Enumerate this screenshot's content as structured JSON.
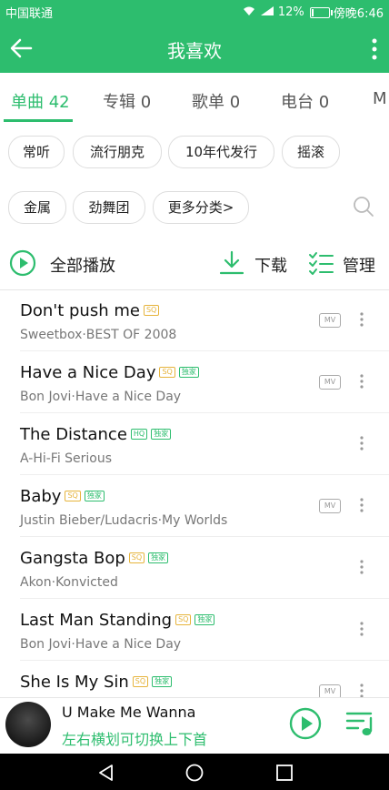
{
  "statusbar": {
    "carrier": "中国联通",
    "battery_pct": "12%",
    "time": "傍晚6:46",
    "battery_level": 0.12
  },
  "header": {
    "title": "我喜欢"
  },
  "tabs": [
    {
      "label": "单曲 42"
    },
    {
      "label": "专辑 0"
    },
    {
      "label": "歌单 0"
    },
    {
      "label": "电台 0"
    },
    {
      "label": "M"
    }
  ],
  "chips": [
    "常听",
    "流行朋克",
    "10年代发行",
    "摇滚",
    "金属",
    "劲舞团",
    "更多分类>"
  ],
  "actions": {
    "play_all": "全部播放",
    "download": "下载",
    "manage": "管理"
  },
  "songs": [
    {
      "title": "Don't push me",
      "badges": [
        "SQ"
      ],
      "subtitle": "Sweetbox·BEST OF 2008",
      "mv": "MV"
    },
    {
      "title": "Have a Nice Day",
      "badges": [
        "SQ",
        "独家"
      ],
      "subtitle": "Bon Jovi·Have a Nice Day",
      "mv": "MV"
    },
    {
      "title": "The Distance",
      "badges": [
        "HQ",
        "独家"
      ],
      "subtitle": "A-Hi-Fi Serious",
      "mv": ""
    },
    {
      "title": "Baby",
      "badges": [
        "SQ",
        "独家"
      ],
      "subtitle": "Justin Bieber/Ludacris·My Worlds",
      "mv": "MV"
    },
    {
      "title": "Gangsta Bop",
      "badges": [
        "SQ",
        "独家"
      ],
      "subtitle": "Akon·Konvicted",
      "mv": ""
    },
    {
      "title": "Last Man Standing",
      "badges": [
        "SQ",
        "独家"
      ],
      "subtitle": "Bon Jovi·Have a Nice Day",
      "mv": ""
    },
    {
      "title": "She Is My Sin",
      "badges": [
        "SQ",
        "独家"
      ],
      "subtitle": "",
      "mv": "MV"
    }
  ],
  "player": {
    "title": "U Make Me Wanna",
    "hint": "左右横划可切换上下首"
  },
  "colors": {
    "accent": "#2dbd6e",
    "sq_badge": "#e6b43c"
  }
}
